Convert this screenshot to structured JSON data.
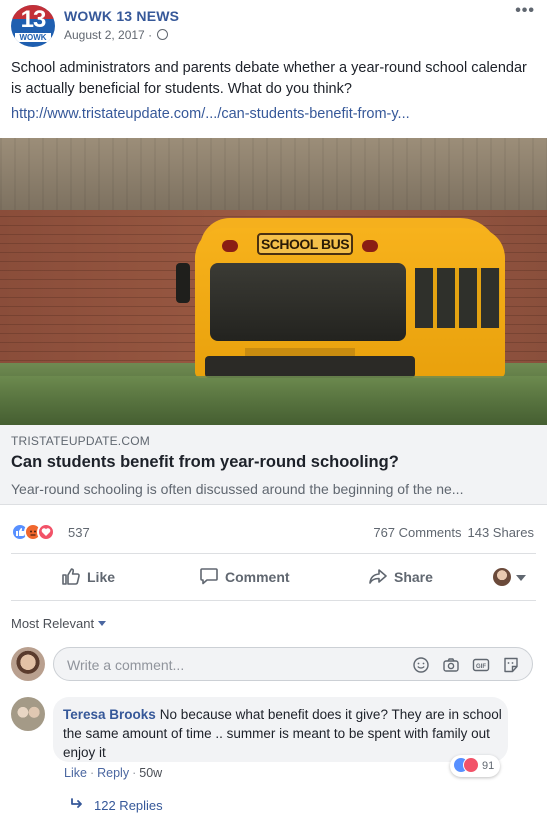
{
  "post": {
    "page_name": "WOWK 13 NEWS",
    "logo_number": "13",
    "logo_wordmark": "WOWK",
    "date": "August 2, 2017",
    "date_separator": " · ",
    "more_icon": "•••",
    "text": "School administrators and parents debate whether a year-round school calendar is actually beneficial for students. What do you think?",
    "url": "http://www.tristateupdate.com/.../can-students-benefit-from-y..."
  },
  "image": {
    "bus_sign": "SCHOOL BUS"
  },
  "link_preview": {
    "domain": "TRISTATEUPDATE.COM",
    "title": "Can students benefit from year-round schooling?",
    "description": "Year-round schooling is often discussed around the beginning of the ne..."
  },
  "reactions": {
    "count": "537",
    "comments": "767 Comments",
    "shares": "143 Shares",
    "icons": [
      "like-icon",
      "angry-icon",
      "love-icon"
    ]
  },
  "actions": {
    "like": "Like",
    "comment": "Comment",
    "share": "Share"
  },
  "comments_section": {
    "sort_label": "Most Relevant",
    "input_placeholder": "Write a comment...",
    "input_icons": [
      "emoji-icon",
      "camera-icon",
      "gif-icon",
      "sticker-icon"
    ]
  },
  "comment": {
    "author": "Teresa Brooks",
    "text": "No because what benefit does it give? They are in school the same amount of time .. summer is meant to be spent with family out enjoy it",
    "reaction_count": "91",
    "like_label": "Like",
    "reply_label": "Reply",
    "age": "50w",
    "replies_label": "122 Replies"
  },
  "colors": {
    "link": "#365899",
    "muted": "#606770",
    "like_blue": "#5890ff",
    "love_red": "#f25268",
    "angry_orange": "#f0672e"
  }
}
